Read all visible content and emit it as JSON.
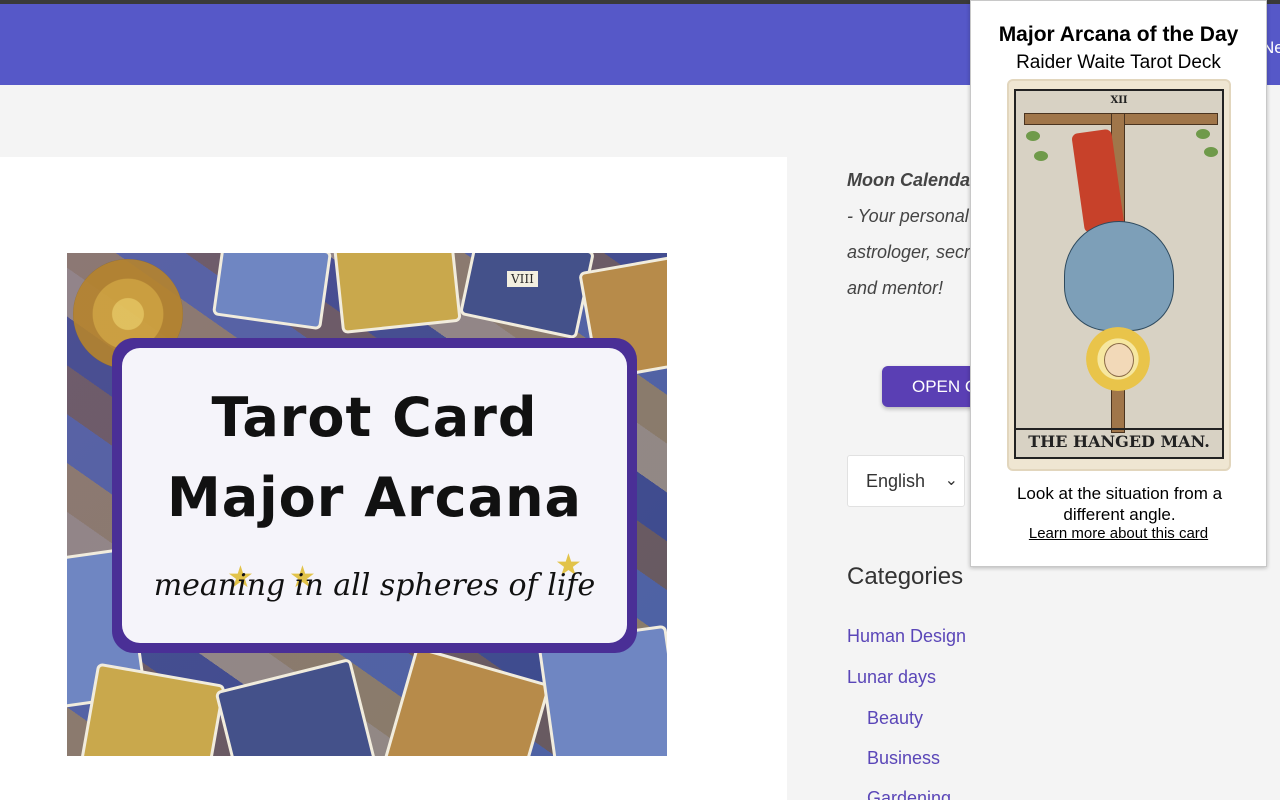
{
  "header": {
    "nav_partial": "Ne"
  },
  "main": {
    "featured_image": {
      "title_line1": "Tarot Card",
      "title_line2": "Major Arcana",
      "subtitle": "meaning in all spheres of life",
      "card_numeral": "VIII"
    }
  },
  "sidebar": {
    "promo": {
      "title": "Moon Calenda",
      "line1": "- Your personal",
      "line2": "astrologer, secr",
      "line3": "and mentor!"
    },
    "open_button_label": "OPEN C",
    "language": {
      "selected": "English"
    },
    "categories": {
      "heading": "Categories",
      "items": [
        {
          "label": "Human Design"
        },
        {
          "label": "Lunar days"
        },
        {
          "label": "Beauty"
        },
        {
          "label": "Business"
        },
        {
          "label": "Gardening"
        }
      ]
    }
  },
  "popup": {
    "title": "Major Arcana of the Day",
    "deck": "Raider Waite Tarot Deck",
    "card": {
      "numeral": "XII",
      "name": "THE HANGED MAN."
    },
    "message": "Look at the situation from a different angle.",
    "link_text": "Learn more about this card"
  },
  "colors": {
    "header": "#5658c8",
    "accent_button": "#5a3fb4",
    "link": "#5a46b8",
    "plaque_border": "#4a2f96"
  }
}
